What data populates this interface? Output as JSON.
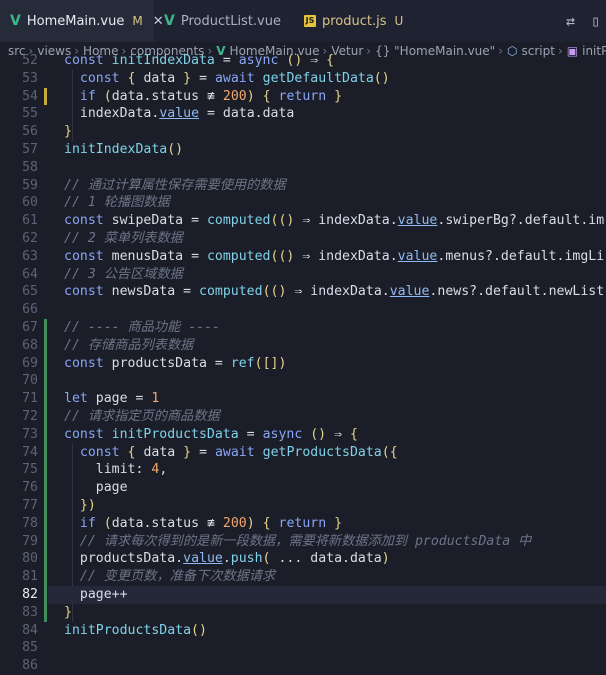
{
  "tabs": [
    {
      "label": "HomeMain.vue",
      "status": "M",
      "icon": "vue-icon",
      "active": true
    },
    {
      "label": "ProductList.vue",
      "status": "",
      "icon": "vue-icon",
      "active": false
    },
    {
      "label": "product.js",
      "status": "U",
      "icon": "js-icon",
      "active": false
    }
  ],
  "breadcrumb": {
    "src": "src",
    "views": "views",
    "home": "Home",
    "components": "components",
    "file": "HomeMain.vue",
    "vetur": "Vetur",
    "component": "{} \"HomeMain.vue\"",
    "script": "script",
    "init": "initP"
  },
  "code": {
    "current_line": 82,
    "lines": [
      {
        "n": "52",
        "t": "  const initIndexData = async () ⇒ {"
      },
      {
        "n": "53",
        "t": "    const { data } = await getDefaultData()"
      },
      {
        "n": "54",
        "t": "    if (data.status ≢ 200) { return }"
      },
      {
        "n": "55",
        "t": "    indexData.value = data.data"
      },
      {
        "n": "56",
        "t": "  }"
      },
      {
        "n": "57",
        "t": "  initIndexData()"
      },
      {
        "n": "58",
        "t": ""
      },
      {
        "n": "59",
        "t": "  // 通过计算属性保存需要使用的数据"
      },
      {
        "n": "60",
        "t": "  // 1 轮播图数据"
      },
      {
        "n": "61",
        "t": "  const swipeData = computed(() ⇒ indexData.value.swiperBg?.default.im"
      },
      {
        "n": "62",
        "t": "  // 2 菜单列表数据"
      },
      {
        "n": "63",
        "t": "  const menusData = computed(() ⇒ indexData.value.menus?.default.imgLi"
      },
      {
        "n": "64",
        "t": "  // 3 公告区域数据"
      },
      {
        "n": "65",
        "t": "  const newsData = computed(() ⇒ indexData.value.news?.default.newList"
      },
      {
        "n": "66",
        "t": ""
      },
      {
        "n": "67",
        "t": "  // ---- 商品功能 ----"
      },
      {
        "n": "68",
        "t": "  // 存储商品列表数据"
      },
      {
        "n": "69",
        "t": "  const productsData = ref([])"
      },
      {
        "n": "70",
        "t": ""
      },
      {
        "n": "71",
        "t": "  let page = 1"
      },
      {
        "n": "72",
        "t": "  // 请求指定页的商品数据"
      },
      {
        "n": "73",
        "t": "  const initProductsData = async () ⇒ {"
      },
      {
        "n": "74",
        "t": "    const { data } = await getProductsData({"
      },
      {
        "n": "75",
        "t": "      limit: 4,"
      },
      {
        "n": "76",
        "t": "      page"
      },
      {
        "n": "77",
        "t": "    })"
      },
      {
        "n": "78",
        "t": "    if (data.status ≢ 200) { return }"
      },
      {
        "n": "79",
        "t": "    // 请求每次得到的是新一段数据，需要将新数据添加到 productsData 中"
      },
      {
        "n": "80",
        "t": "    productsData.value.push( ... data.data)"
      },
      {
        "n": "81",
        "t": "    // 变更页数，准备下次数据请求"
      },
      {
        "n": "82",
        "t": "    page++"
      },
      {
        "n": "83",
        "t": "  }"
      },
      {
        "n": "84",
        "t": "  initProductsData()"
      },
      {
        "n": "85",
        "t": ""
      },
      {
        "n": "86",
        "t": ""
      }
    ]
  }
}
